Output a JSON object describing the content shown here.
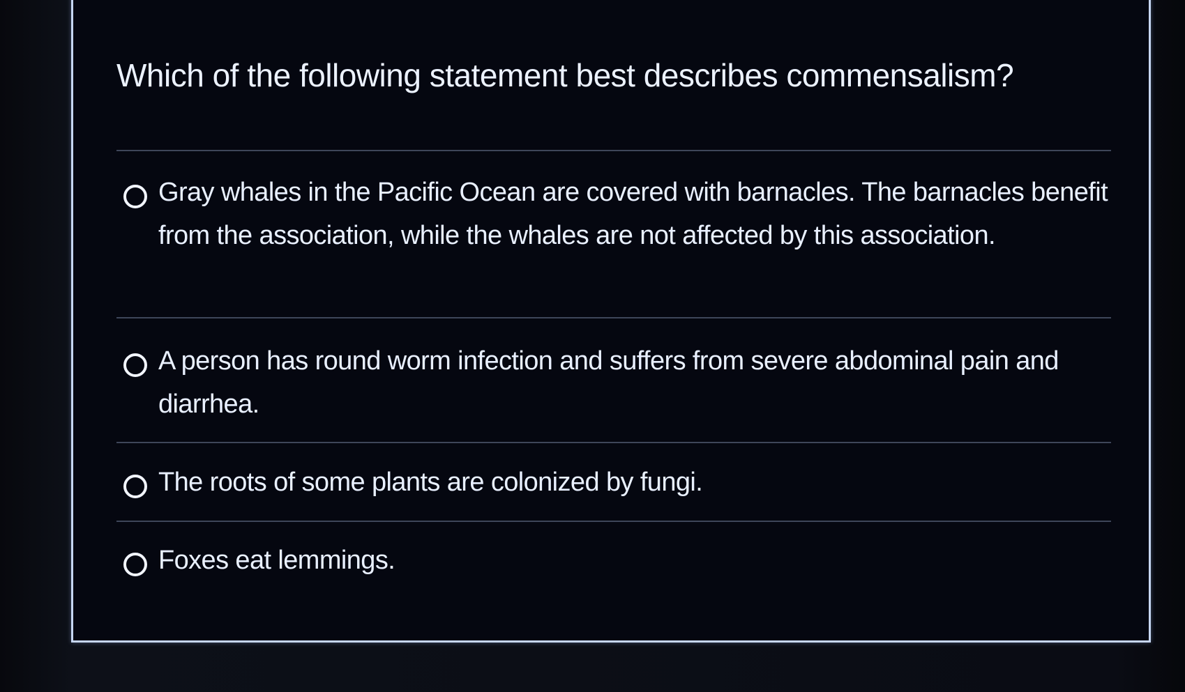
{
  "quiz": {
    "question": "Which of the following statement best describes commensalism?",
    "options": [
      {
        "label": "Gray whales in the Pacific Ocean are covered with barnacles. The barnacles benefit from the association, while the whales are not affected by this association.",
        "selected": false
      },
      {
        "label": "A person has round worm infection and suffers from severe abdominal pain and diarrhea.",
        "selected": false
      },
      {
        "label": "The roots of some plants are colonized by fungi.",
        "selected": false
      },
      {
        "label": "Foxes eat lemmings.",
        "selected": false
      }
    ]
  },
  "colors": {
    "background": "#050710",
    "text": "#e9f0ff",
    "border": "#c6d6f2",
    "divider": "#3e4659"
  }
}
